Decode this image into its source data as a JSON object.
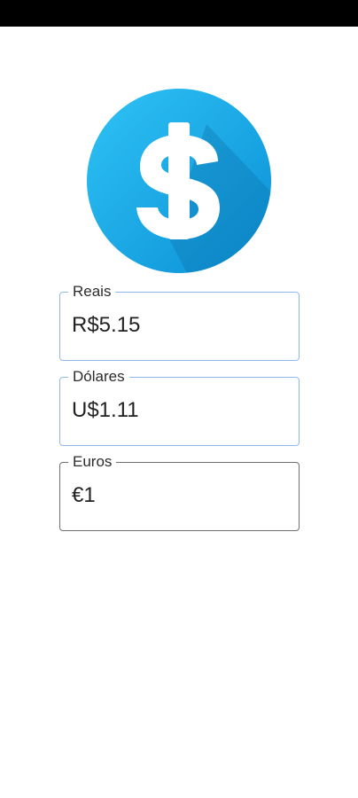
{
  "logo": {
    "icon": "dollar-sign-circle-icon",
    "colors": {
      "circle_start": "#29b6f6",
      "circle_end": "#0288d1",
      "symbol": "#ffffff"
    }
  },
  "fields": [
    {
      "label": "Reais",
      "value": "R$5.15",
      "state": "focused-style"
    },
    {
      "label": "Dólares",
      "value": "U$1.11",
      "state": "focused-style"
    },
    {
      "label": "Euros",
      "value": "€1",
      "state": "default"
    }
  ],
  "colors": {
    "active_border": "#8db8e8",
    "inactive_border": "#6f6f6f"
  }
}
